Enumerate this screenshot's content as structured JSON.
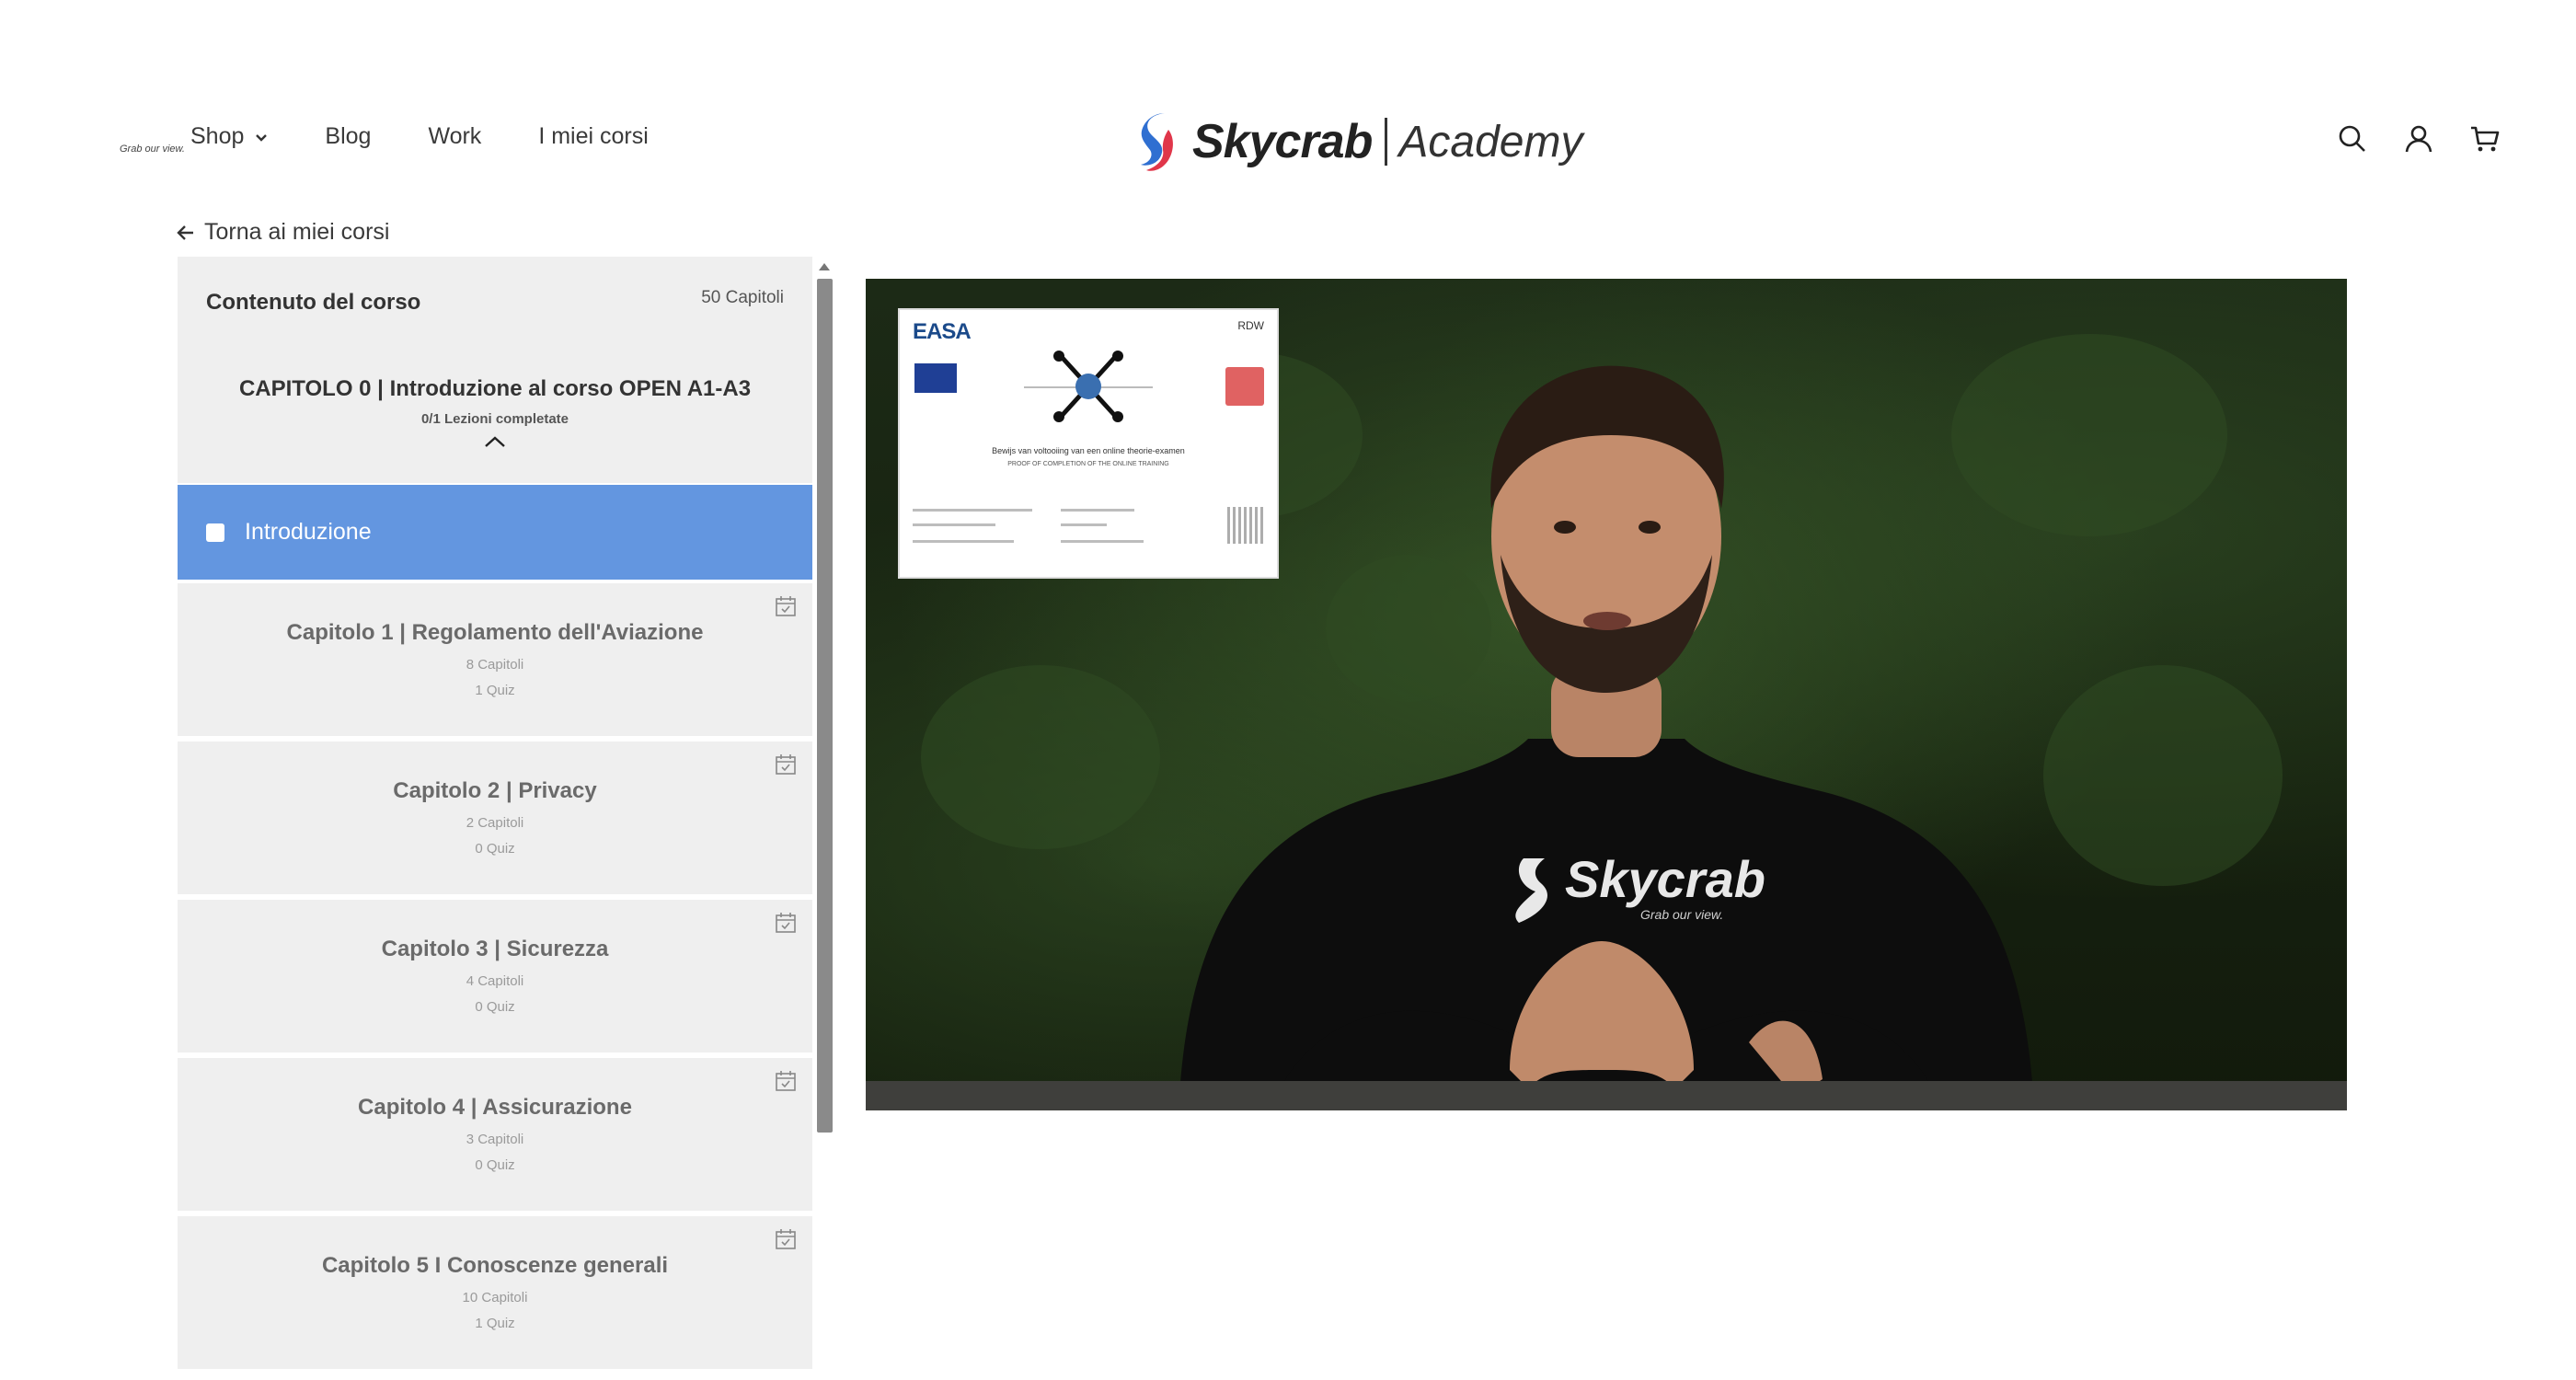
{
  "header": {
    "nav": [
      {
        "label": "Shop",
        "has_dropdown": true
      },
      {
        "label": "Blog",
        "has_dropdown": false
      },
      {
        "label": "Work",
        "has_dropdown": false
      },
      {
        "label": "I miei corsi",
        "has_dropdown": false
      }
    ],
    "logo": {
      "brand": "Skycrab",
      "tagline": "Grab our view.",
      "suffix": "Academy"
    },
    "icons": [
      "search-icon",
      "account-icon",
      "cart-icon"
    ]
  },
  "back_link": {
    "label": "Torna ai miei corsi",
    "icon": "arrow-left-icon"
  },
  "sidebar": {
    "title": "Contenuto del corso",
    "count": "50 Capitoli",
    "current_chapter": {
      "title": "CAPITOLO 0 | Introduzione al corso OPEN A1-A3",
      "progress": "0/1 Lezioni completate",
      "expanded": true,
      "lessons": [
        {
          "label": "Introduzione",
          "completed": false,
          "active": true
        }
      ]
    },
    "chapters": [
      {
        "title": "Capitolo 1 | Regolamento dell'Aviazione",
        "chapters": "8 Capitoli",
        "quiz": "1 Quiz"
      },
      {
        "title": "Capitolo 2 | Privacy",
        "chapters": "2 Capitoli",
        "quiz": "0 Quiz"
      },
      {
        "title": "Capitolo 3 | Sicurezza",
        "chapters": "4 Capitoli",
        "quiz": "0 Quiz"
      },
      {
        "title": "Capitolo 4 | Assicurazione",
        "chapters": "3 Capitoli",
        "quiz": "0 Quiz"
      },
      {
        "title": "Capitolo 5 I Conoscenze generali",
        "chapters": "10 Capitoli",
        "quiz": "1 Quiz"
      }
    ]
  },
  "video": {
    "overlay_card": {
      "logo": "EASA",
      "agency": "RDW",
      "line1": "Bewijs van voltooiing van een online theorie-examen",
      "line2": "PROOF OF COMPLETION OF THE ONLINE TRAINING"
    },
    "shirt_brand": "Skycrab",
    "shirt_tagline": "Grab our view."
  },
  "colors": {
    "active_lesson": "#6396e0",
    "panel_bg": "#efefef",
    "text_dark": "#333333"
  }
}
